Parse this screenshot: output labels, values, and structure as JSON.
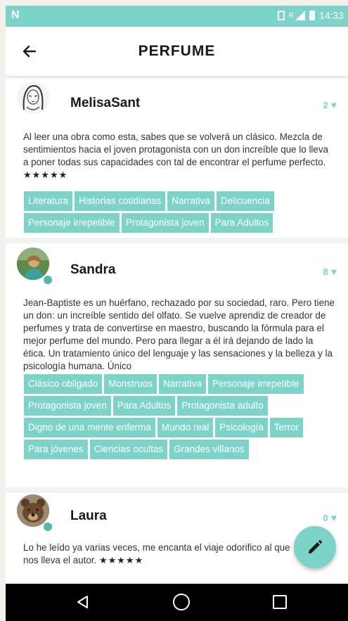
{
  "status_bar": {
    "carrier_icon": "N",
    "signal_label": "R",
    "time": "14:33"
  },
  "app_bar": {
    "title": "PERFUME",
    "back_icon": "arrow-left"
  },
  "reviews": [
    {
      "username": "MelisaSant",
      "likes": "2",
      "text": "Al leer una obra como esta, sabes que se volverá un clásico.  Mezcla de sentimientos hacia el joven protagonista con un don increíble que lo lleva a poner todas sus capacidades con tal de encontrar el perfume perfecto.",
      "stars": "★★★★★",
      "tags": [
        "Literatura",
        "Historias cotidianas",
        "Narrativa",
        "Delicuencia",
        "Personaje irrepetible",
        "Protagonista joven",
        "Para Adultos"
      ]
    },
    {
      "username": "Sandra",
      "likes": "8",
      "text": "Jean-Baptiste es un huérfano, rechazado por su sociedad, raro. Pero tiene un don: un increíble sentido del olfato. Se vuelve aprendiz de creador de perfumes y trata de convertirse en maestro, buscando la fórmula para el mejor perfume del mundo. Pero para llegar a él irá dejando de lado la ética. Un tratamiento único del lenguaje y las sensaciones y la belleza y la psicología humana. Único",
      "stars": "",
      "tags": [
        "Clásico obligado",
        "Monstruos",
        "Narrativa",
        "Personaje irrepetible",
        "Protagonista joven",
        "Para Adultos",
        "Protagonista adulto",
        "Digno de una mente enferma",
        "Mundo real",
        "Psicología",
        "Terror",
        "Para jóvenes",
        "Ciencias ocultas",
        "Grandes villanos"
      ]
    },
    {
      "username": "Laura",
      "likes": "0",
      "text": "Lo he leído ya varias veces, me encanta el viaje odorifico al que nos lleva el autor.",
      "stars": "★★★★★",
      "tags": []
    }
  ],
  "fab": {
    "icon": "pencil-icon"
  },
  "nav": {
    "back": "back-triangle",
    "home": "home-circle",
    "recent": "recent-square"
  },
  "colors": {
    "accent": "#7ed3c9",
    "text": "#333333"
  }
}
